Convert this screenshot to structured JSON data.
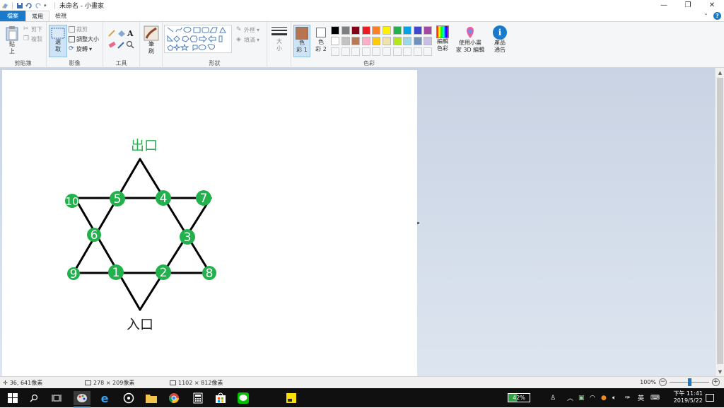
{
  "app": {
    "title": "未命名 - 小畫家",
    "window_controls": {
      "minimize": "—",
      "maximize": "❐",
      "close": "✕"
    }
  },
  "tabs": [
    {
      "label": "檔案"
    },
    {
      "label": "常用"
    },
    {
      "label": "檢視"
    }
  ],
  "ribbon": {
    "clipboard": {
      "label": "剪貼簿",
      "paste": "貼",
      "paste2": "上",
      "cut": "剪下",
      "copy": "複製"
    },
    "image": {
      "label": "影像",
      "select": "選",
      "select2": "取",
      "crop": "裁剪",
      "resize": "調整大小",
      "rotate": "旋轉"
    },
    "tools": {
      "label": "工具"
    },
    "brushes": {
      "label": "筆",
      "label2": "刷"
    },
    "shapes": {
      "label": "形狀",
      "outline": "外框",
      "fill": "填滿"
    },
    "size": {
      "label": "大",
      "label2": "小"
    },
    "colors": {
      "label": "色彩",
      "color1_a": "色",
      "color1_b": "彩 1",
      "color2_a": "色",
      "color2_b": "彩 2",
      "edit": "編輯",
      "edit2": "色彩",
      "paint3d": "使用小畫",
      "paint3d2": "家 3D 編輯",
      "product": "產品",
      "product2": "通告",
      "color1_value": "#b87450",
      "color2_value": "#ffffff",
      "palette_row1": [
        "#000000",
        "#7f7f7f",
        "#880015",
        "#ed1c24",
        "#ff7f27",
        "#fff200",
        "#22b14c",
        "#00a2e8",
        "#3f48cc",
        "#a349a4"
      ],
      "palette_row2": [
        "#ffffff",
        "#c3c3c3",
        "#b97a57",
        "#ffaec9",
        "#ffc90e",
        "#efe4b0",
        "#b5e61d",
        "#99d9ea",
        "#7092be",
        "#c8bfe7"
      ]
    }
  },
  "canvas": {
    "exit_label": "出口",
    "entrance_label": "入口",
    "node_color": "#22b14c",
    "line_color": "#000000",
    "nodes": [
      "1",
      "2",
      "3",
      "4",
      "5",
      "6",
      "7",
      "8",
      "9",
      "10"
    ]
  },
  "status": {
    "cursor": "36, 641像素",
    "selection": "278 × 209像素",
    "size": "1102 × 812像素",
    "zoom": "100%"
  },
  "taskbar": {
    "battery": "42%",
    "ime": "英",
    "time_period": "下午 11:41",
    "date": "2019/5/22"
  }
}
